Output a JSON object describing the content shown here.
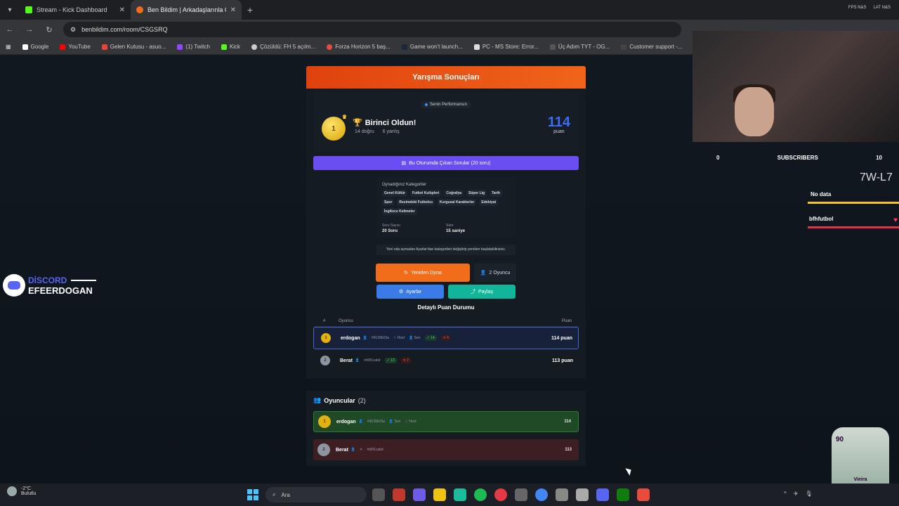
{
  "browser": {
    "tabs": [
      {
        "title": "Stream - Kick Dashboard",
        "color": "#53fc18"
      },
      {
        "title": "Ben Bildim | Arkadaşlarınla Onl",
        "color": "#f26d1a"
      }
    ],
    "url": "benbildim.com/room/CSGSRQ",
    "bookmarks": [
      "Google",
      "YouTube",
      "Gelen Kutusu - asuo...",
      "(1) Twitch",
      "Kick",
      "Çözüldü: FH 5 açılm...",
      "Forza Horizon 5 baş...",
      "Game won't launch...",
      "PC - MS Store: Error...",
      "Üç Adım TYT - OG...",
      "Customer support -..."
    ],
    "tray_top": [
      "FPS N&S",
      "LAT N&S"
    ]
  },
  "results": {
    "header": "Yarışma Sonuçları",
    "perf_label": "Senin Performansın",
    "rank": "1",
    "title": "Birinci Oldun!",
    "correct": "14 doğru",
    "wrong": "6 yanlış",
    "score": "114",
    "score_unit": "puan",
    "questions_btn": "Bu Oturumda Çıkan Sorular (20 soru)",
    "cat_title": "Oynadığınız Kategoriler",
    "categories": [
      "Genel Kültür",
      "Futbol Kulüpleri",
      "Coğrafya",
      "Süper Lig",
      "Tarih",
      "Spor",
      "Resimdeki Futbolcu",
      "Kurgusal Karakterler",
      "Edebiyat",
      "İngilizce Kelimeler"
    ],
    "q_count_label": "Soru Sayısı",
    "q_count": "20 Soru",
    "time_label": "Süre",
    "time": "15 saniye",
    "note": "Yeni oda açmadan Ayarlar'dan kategorileri değiştirip yeniden başlatabilirsiniz.",
    "replay": "Yeniden Oyna",
    "players_btn": "2 Oyuncu",
    "settings": "Ayarlar",
    "share": "Paylaş",
    "detail_title": "Detaylı Puan Durumu",
    "col_rank": "#",
    "col_player": "Oyuncu",
    "col_points": "Puan",
    "rows": [
      {
        "rank": "1",
        "name": "erdogan",
        "id": "#9139b15a",
        "host": "Host",
        "you": "Sen",
        "ok": "14",
        "bad": "6",
        "points": "114 puan"
      },
      {
        "rank": "2",
        "name": "Berat",
        "id": "#d0f1cabd",
        "ok": "13",
        "bad": "7",
        "points": "113 puan"
      }
    ]
  },
  "players": {
    "title": "Oyuncular",
    "count": "(2)",
    "list": [
      {
        "rank": "1",
        "name": "erdogan",
        "id": "#9139b15a",
        "you": "Sen",
        "host": "Host",
        "score": "114"
      },
      {
        "rank": "2",
        "name": "Berat",
        "id": "#d0f1cabd",
        "score": "113"
      }
    ]
  },
  "overlay": {
    "subs_left": "0",
    "subs_label": "SUBSCRIBERS",
    "subs_right": "10",
    "code": "7W-L7",
    "bar1": "No data",
    "bar2": "bfhfutbol",
    "discord_label": "DİSCORD",
    "discord_name": "EFEERDOGAN",
    "card_rating": "90",
    "card_name": "Vieira"
  },
  "taskbar": {
    "temp": "-2°C",
    "weather": "Bulutlu",
    "search": "Ara"
  }
}
